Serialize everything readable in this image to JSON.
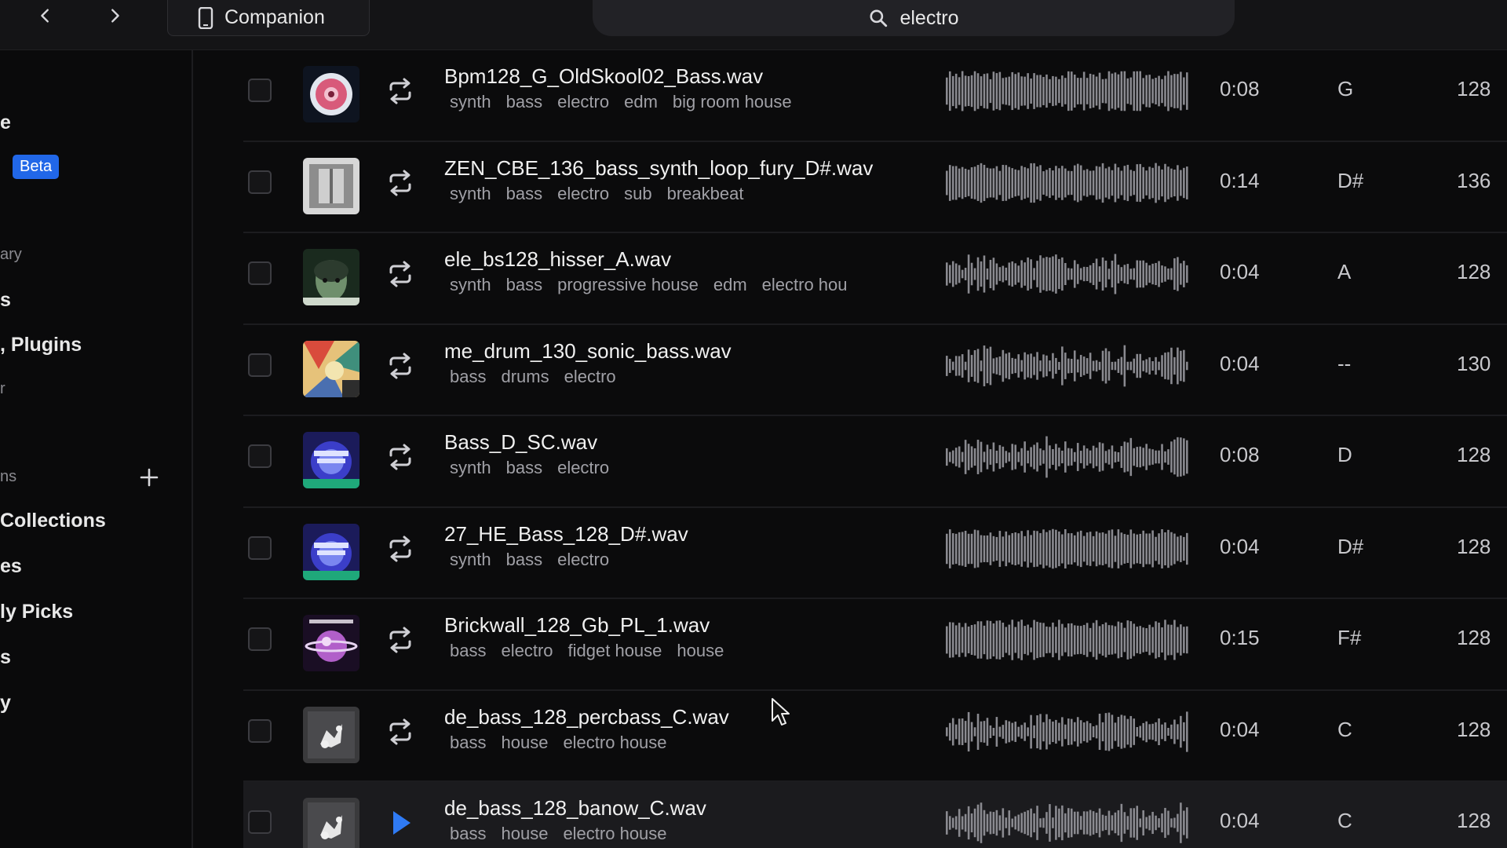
{
  "topbar": {
    "companion_label": "Companion",
    "search_value": "electro"
  },
  "sidebar": {
    "items": [
      {
        "label": "e",
        "style": "bold"
      },
      {
        "label": "Beta",
        "style": "badge"
      },
      {
        "label": "ary",
        "style": "dim"
      },
      {
        "label": "s",
        "style": "bold"
      },
      {
        "label": ", Plugins",
        "style": "bold"
      },
      {
        "label": "r",
        "style": "dim"
      },
      {
        "label": "ns",
        "style": "dim"
      },
      {
        "label": "Collections",
        "style": "bold"
      },
      {
        "label": "es",
        "style": "bold"
      },
      {
        "label": "ly Picks",
        "style": "bold"
      },
      {
        "label": "s",
        "style": "bold"
      },
      {
        "label": "y",
        "style": "bold"
      }
    ]
  },
  "samples": [
    {
      "name": "Bpm128_G_OldSkool02_Bass.wav",
      "tags": [
        "synth",
        "bass",
        "electro",
        "edm",
        "big room house"
      ],
      "duration": "0:08",
      "key": "G",
      "bpm": "128",
      "art": "pink-flower"
    },
    {
      "name": "ZEN_CBE_136_bass_synth_loop_fury_D#.wav",
      "tags": [
        "synth",
        "bass",
        "electro",
        "sub",
        "breakbeat"
      ],
      "duration": "0:14",
      "key": "D#",
      "bpm": "136",
      "art": "grey-box"
    },
    {
      "name": "ele_bs128_hisser_A.wav",
      "tags": [
        "synth",
        "bass",
        "progressive house",
        "edm",
        "electro hou"
      ],
      "duration": "0:04",
      "key": "A",
      "bpm": "128",
      "art": "green-face"
    },
    {
      "name": "me_drum_130_sonic_bass.wav",
      "tags": [
        "bass",
        "drums",
        "electro"
      ],
      "duration": "0:04",
      "key": "--",
      "bpm": "130",
      "art": "colorful-collage"
    },
    {
      "name": "Bass_D_SC.wav",
      "tags": [
        "synth",
        "bass",
        "electro"
      ],
      "duration": "0:08",
      "key": "D",
      "bpm": "128",
      "art": "heavy-blue"
    },
    {
      "name": "27_HE_Bass_128_D#.wav",
      "tags": [
        "synth",
        "bass",
        "electro"
      ],
      "duration": "0:04",
      "key": "D#",
      "bpm": "128",
      "art": "heavy-blue"
    },
    {
      "name": "Brickwall_128_Gb_PL_1.wav",
      "tags": [
        "bass",
        "electro",
        "fidget house",
        "house"
      ],
      "duration": "0:15",
      "key": "F#",
      "bpm": "128",
      "art": "purple-planet"
    },
    {
      "name": "de_bass_128_percbass_C.wav",
      "tags": [
        "bass",
        "house",
        "electro house"
      ],
      "duration": "0:04",
      "key": "C",
      "bpm": "128",
      "art": "grey-splat"
    },
    {
      "name": "de_bass_128_banow_C.wav",
      "tags": [
        "bass",
        "house",
        "electro house"
      ],
      "duration": "0:04",
      "key": "C",
      "bpm": "128",
      "art": "grey-splat",
      "playing": true
    }
  ],
  "icons": {
    "back": "chevron-left-icon",
    "forward": "chevron-right-icon",
    "companion": "phone-icon",
    "search": "search-icon",
    "loop": "loop-icon",
    "play": "play-icon",
    "add": "plus-icon"
  },
  "colors": {
    "accent": "#2167e8",
    "play": "#2f7bf5"
  }
}
